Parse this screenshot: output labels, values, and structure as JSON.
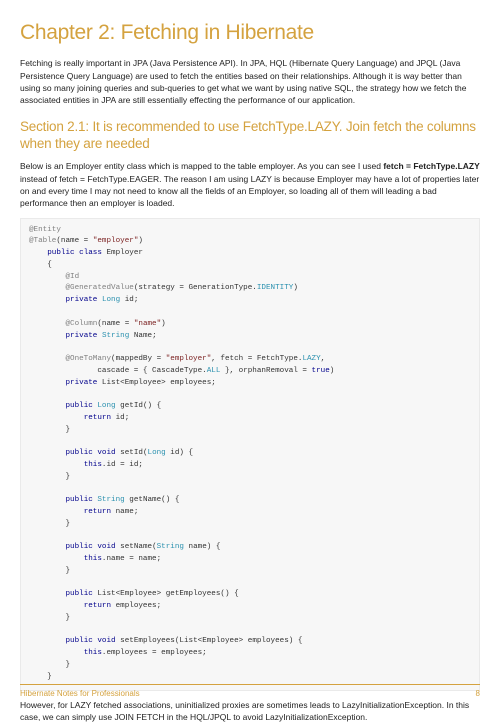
{
  "chapter_title": "Chapter 2: Fetching in Hibernate",
  "intro": "Fetching is really important in JPA (Java Persistence API). In JPA, HQL (Hibernate Query Language) and JPQL (Java Persistence Query Language) are used to fetch the entities based on their relationships. Although it is way better than using so many joining queries and sub-queries to get what we want by using native SQL, the strategy how we fetch the associated entities in JPA are still essentially effecting the performance of our application.",
  "section_title": "Section 2.1: It is recommended to use FetchType.LAZY. Join fetch the columns when they are needed",
  "section_intro_prefix": "Below is an Employer entity class which is mapped to the table employer. As you can see I used ",
  "section_intro_bold": "fetch = FetchType.LAZY",
  "section_intro_suffix": " instead of fetch = FetchType.EAGER. The reason I am using LAZY is because Employer may have a lot of properties later on and every time I may not need to know all the fields of an Employer, so loading all of them will leading a bad performance then an employer is loaded.",
  "code": {
    "l1": "@Entity",
    "l2a": "@Table",
    "l2b": "(name = ",
    "l2c": "\"employer\"",
    "l2d": ")",
    "l3a": "    ",
    "l3b": "public",
    "l3c": " ",
    "l3d": "class",
    "l3e": " Employer",
    "l4": "    {",
    "l5": "        @Id",
    "l6a": "        @GeneratedValue",
    "l6b": "(strategy = GenerationType.",
    "l6c": "IDENTITY",
    "l6d": ")",
    "l7a": "        ",
    "l7b": "private",
    "l7c": " ",
    "l7d": "Long",
    "l7e": " id;",
    "l8": "",
    "l9a": "        @Column",
    "l9b": "(name = ",
    "l9c": "\"name\"",
    "l9d": ")",
    "l10a": "        ",
    "l10b": "private",
    "l10c": " ",
    "l10d": "String",
    "l10e": " Name;",
    "l11": "",
    "l12a": "        @OneToMany",
    "l12b": "(mappedBy = ",
    "l12c": "\"employer\"",
    "l12d": ", fetch = FetchType.",
    "l12e": "LAZY",
    "l12f": ",",
    "l13a": "               cascade = { CascadeType.",
    "l13b": "ALL",
    "l13c": " }, orphanRemoval = ",
    "l13d": "true",
    "l13e": ")",
    "l14a": "        ",
    "l14b": "private",
    "l14c": " List<Employee> employees;",
    "l15": "",
    "l16a": "        ",
    "l16b": "public",
    "l16c": " ",
    "l16d": "Long",
    "l16e": " getId() {",
    "l17a": "            ",
    "l17b": "return",
    "l17c": " id;",
    "l18": "        }",
    "l19": "",
    "l20a": "        ",
    "l20b": "public",
    "l20c": " ",
    "l20d": "void",
    "l20e": " setId(",
    "l20f": "Long",
    "l20g": " id) {",
    "l21a": "            ",
    "l21b": "this",
    "l21c": ".id = id;",
    "l22": "        }",
    "l23": "",
    "l24a": "        ",
    "l24b": "public",
    "l24c": " ",
    "l24d": "String",
    "l24e": " getName() {",
    "l25a": "            ",
    "l25b": "return",
    "l25c": " name;",
    "l26": "        }",
    "l27": "",
    "l28a": "        ",
    "l28b": "public",
    "l28c": " ",
    "l28d": "void",
    "l28e": " setName(",
    "l28f": "String",
    "l28g": " name) {",
    "l29a": "            ",
    "l29b": "this",
    "l29c": ".name = name;",
    "l30": "        }",
    "l31": "",
    "l32a": "        ",
    "l32b": "public",
    "l32c": " List<Employee> getEmployees() {",
    "l33a": "            ",
    "l33b": "return",
    "l33c": " employees;",
    "l34": "        }",
    "l35": "",
    "l36a": "        ",
    "l36b": "public",
    "l36c": " ",
    "l36d": "void",
    "l36e": " setEmployees(List<Employee> employees) {",
    "l37a": "            ",
    "l37b": "this",
    "l37c": ".employees = employees;",
    "l38": "        }",
    "l39": "    }"
  },
  "closing": "However, for LAZY fetched associations, uninitialized proxies are sometimes leads to LazyInitializationException. In this case, we can simply use JOIN FETCH in the HQL/JPQL to avoid LazyInitializationException.",
  "footer_left": "Hibernate Notes for Professionals",
  "footer_right": "8"
}
